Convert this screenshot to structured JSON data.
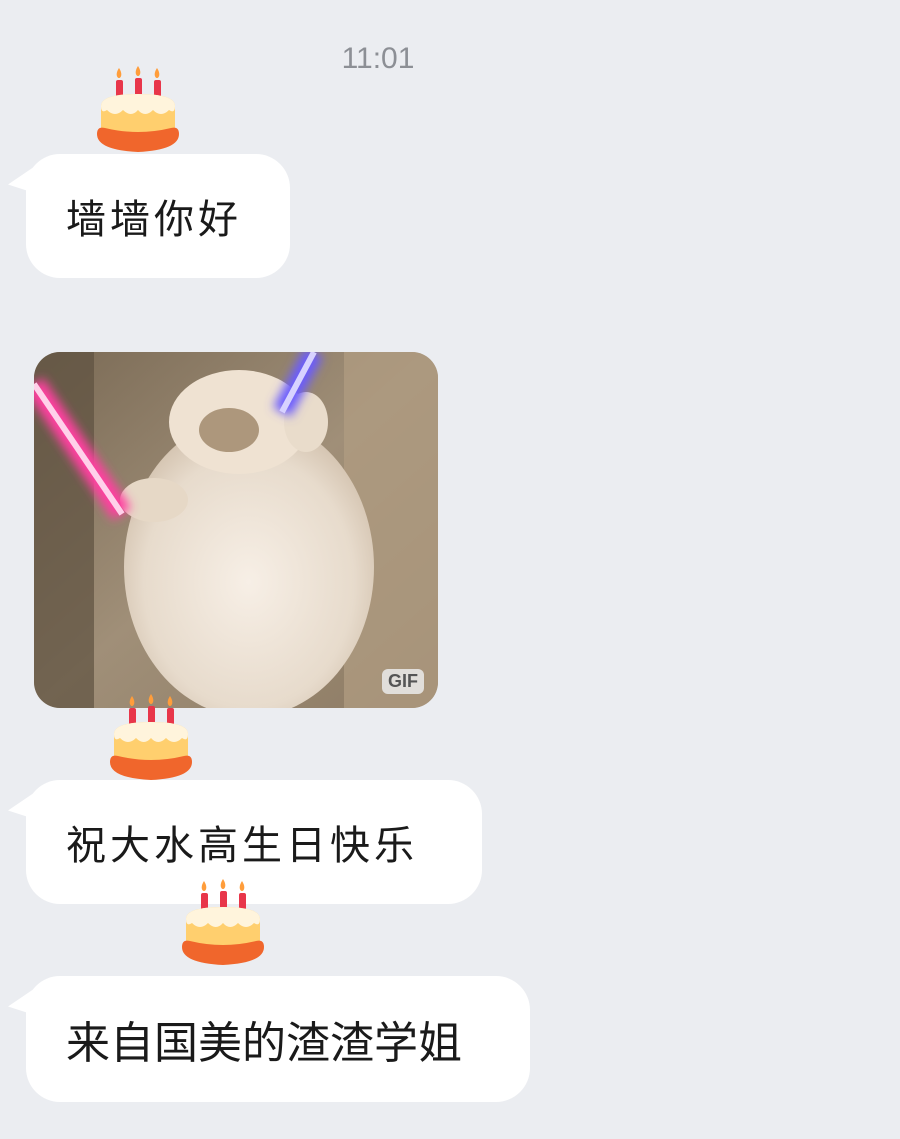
{
  "header": {
    "timestamp": "11:01"
  },
  "messages": [
    {
      "text": "墙墙你好",
      "decoration": "birthday-cake-icon"
    },
    {
      "type": "gif",
      "badge": "GIF",
      "subject": "cat-with-lightsabers"
    },
    {
      "text": "祝大水高生日快乐",
      "decoration": "birthday-cake-icon"
    },
    {
      "text": "来自国美的渣渣学姐",
      "decoration": "birthday-cake-icon"
    }
  ],
  "colors": {
    "background": "#ebedf1",
    "bubble": "#ffffff",
    "text": "#1a1a1a",
    "timestamp": "#8c8f95"
  }
}
